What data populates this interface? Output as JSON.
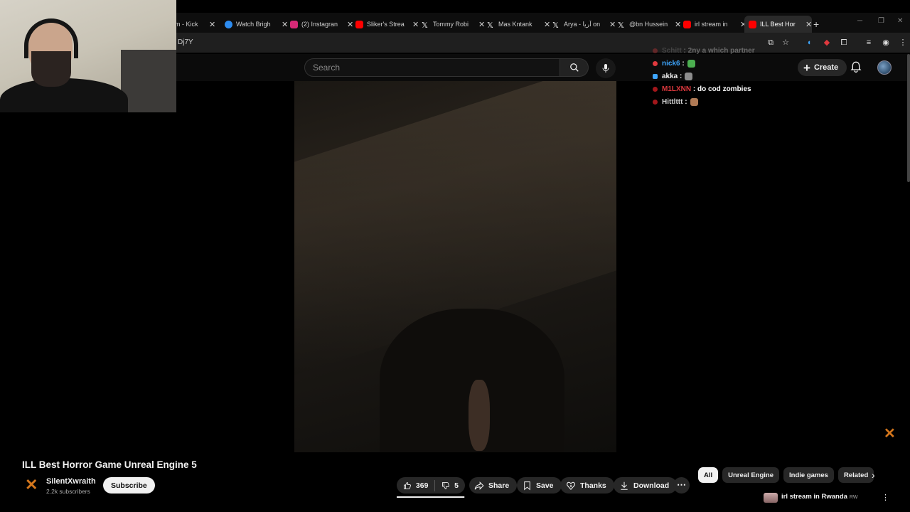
{
  "browser": {
    "tabs": [
      {
        "label": "eam - Kick",
        "color": "#53fc18"
      },
      {
        "label": "Watch Brigh",
        "color": "#2d8cf0"
      },
      {
        "label": "(2) Instagran",
        "color": "#d62976"
      },
      {
        "label": "Sliker's Strea",
        "color": "#ff0000"
      },
      {
        "label": "Tommy Robi",
        "color": "#ffffff"
      },
      {
        "label": "Mas Kntank",
        "color": "#ffffff"
      },
      {
        "label": "Arya - آریا on",
        "color": "#ffffff"
      },
      {
        "label": "@bn Hussein",
        "color": "#ffffff"
      },
      {
        "label": "irl stream in",
        "color": "#ff0000"
      },
      {
        "label": "ILL Best Hor",
        "color": "#ff0000"
      }
    ],
    "url_fragment": "Dj7Y",
    "new_tab": "+"
  },
  "youtube": {
    "search_placeholder": "Search",
    "create_label": "Create"
  },
  "chat": [
    {
      "user": "Schitt",
      "msg": "2ny a which partner",
      "user_color": "#888888",
      "emote_color": ""
    },
    {
      "user": "nick6",
      "msg": "",
      "user_color": "#3ea6ff",
      "emote_color": "#4caf50"
    },
    {
      "user": "akka",
      "msg": "",
      "user_color": "#f1f1f1",
      "emote_color": "#8d8d8d"
    },
    {
      "user": "M1LXNN",
      "msg": "do cod zombies",
      "user_color": "#e0393e",
      "emote_color": ""
    },
    {
      "user": "Hittlttt",
      "msg": "",
      "user_color": "#d0d0d0",
      "emote_color": "#b07a55"
    }
  ],
  "video": {
    "title": "ILL Best Horror Game Unreal Engine 5",
    "channel": "SilentXwraith",
    "subscribers": "2.2k subscribers",
    "subscribe_label": "Subscribe",
    "likes": "369",
    "dislikes": "5",
    "like_ratio": 0.987,
    "actions": {
      "share": "Share",
      "save": "Save",
      "thanks": "Thanks",
      "download": "Download",
      "more": "⋯"
    }
  },
  "chips": [
    "All",
    "Unreal Engine",
    "Indie games",
    "Related"
  ],
  "related": {
    "title": "irl stream in Rwanda",
    "flag": "RW"
  },
  "colors": {
    "accent": "#d4761c",
    "youtube_red": "#ff0000",
    "chip_active_bg": "#f1f1f1"
  },
  "icons": [
    "search-icon",
    "mic-icon",
    "plus-icon",
    "bell-icon",
    "like-icon",
    "dislike-icon",
    "share-icon",
    "save-icon",
    "thanks-icon",
    "download-icon",
    "chevron-right-icon",
    "close-icon",
    "star-icon",
    "extensions-icon"
  ]
}
